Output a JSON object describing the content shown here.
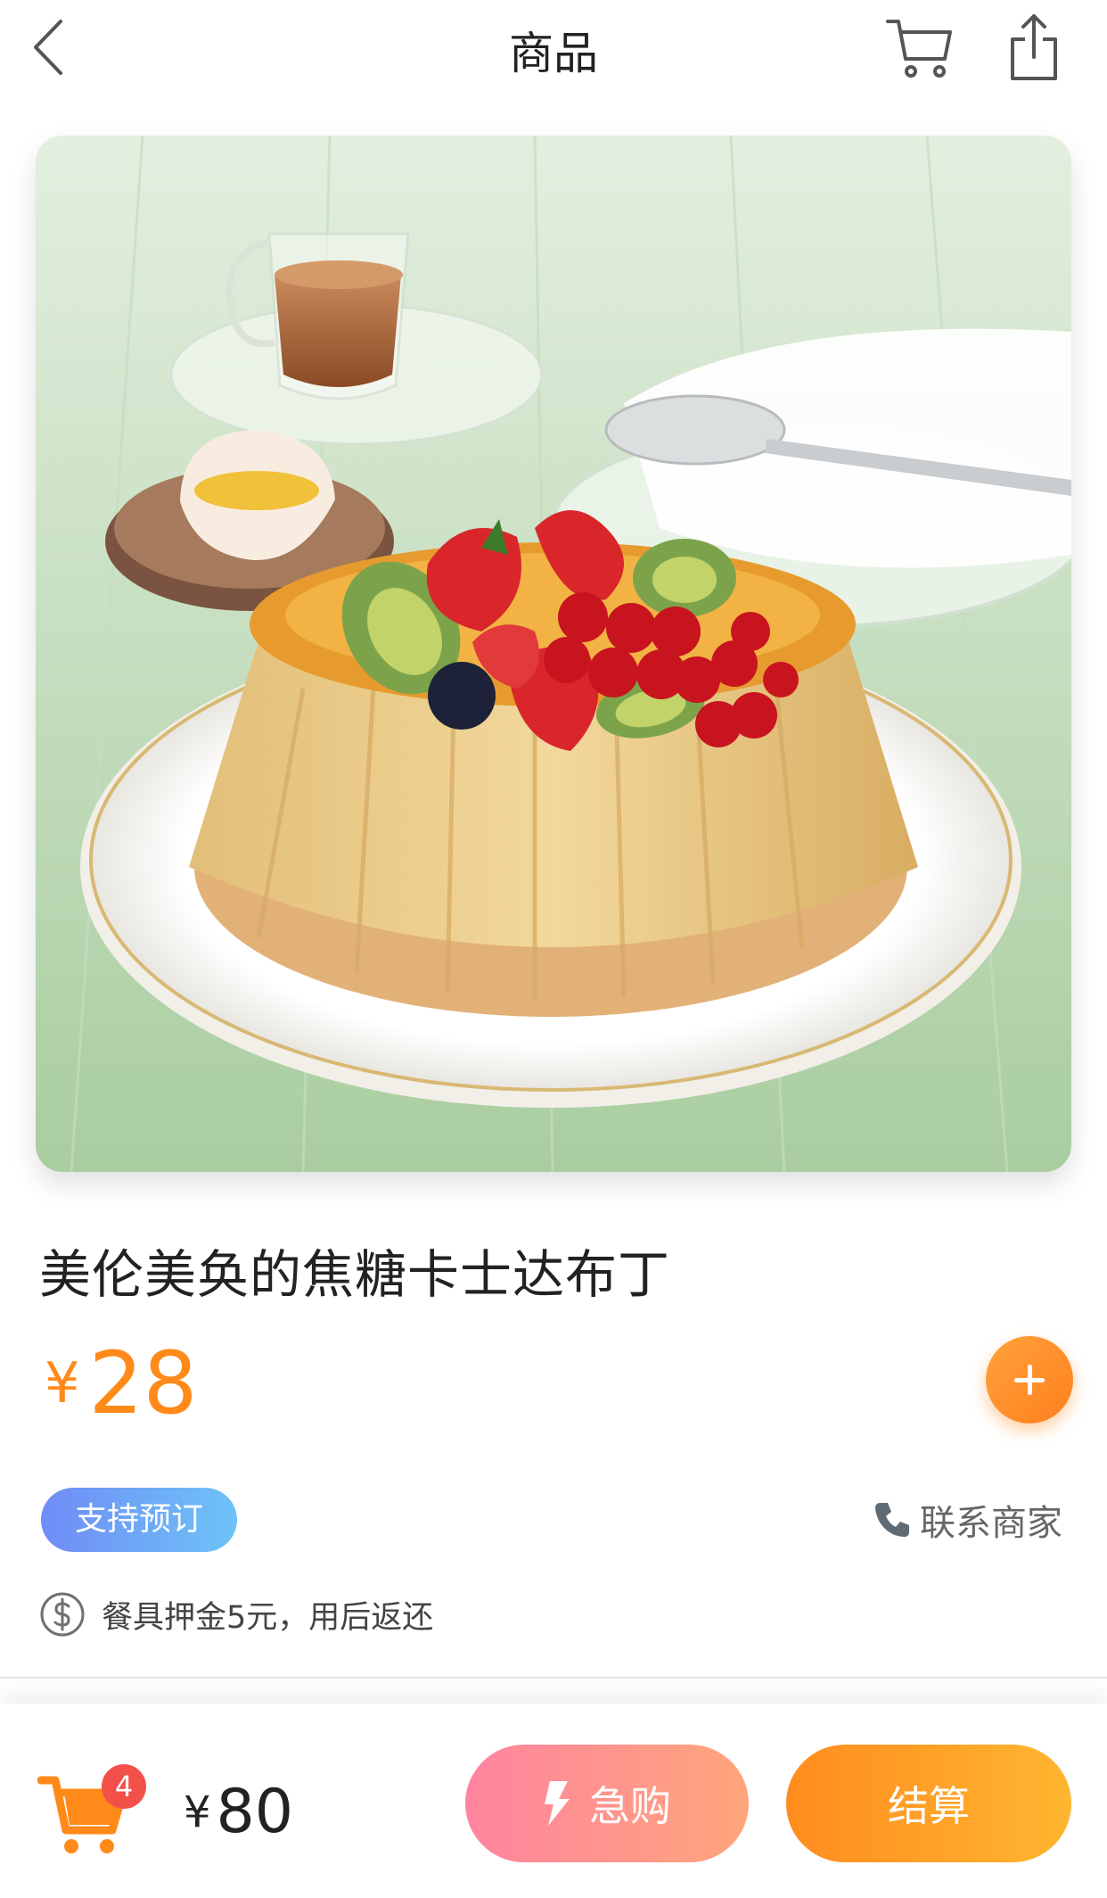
{
  "header": {
    "title": "商品",
    "icons": {
      "back": "chevron-left-icon",
      "cart": "cart-icon",
      "share": "share-icon"
    }
  },
  "product": {
    "name": "美伦美奂的焦糖卡士达布丁",
    "price_symbol": "¥",
    "price": "28",
    "tag": "支持预订",
    "contact_label": "联系商家",
    "deposit_note": "餐具押金5元，用后返还"
  },
  "bottom_bar": {
    "cart_count": "4",
    "total_symbol": "¥",
    "total": "80",
    "rush_label": "急购",
    "checkout_label": "结算"
  },
  "colors": {
    "accent": "#ff8a1a",
    "badge": "#f4504a",
    "tag_start": "#6f8cf6",
    "tag_end": "#6ec3f7",
    "rush_start": "#ff849f",
    "rush_end": "#ffa57b",
    "checkout_start": "#ff8c1e",
    "checkout_end": "#ffb630"
  }
}
